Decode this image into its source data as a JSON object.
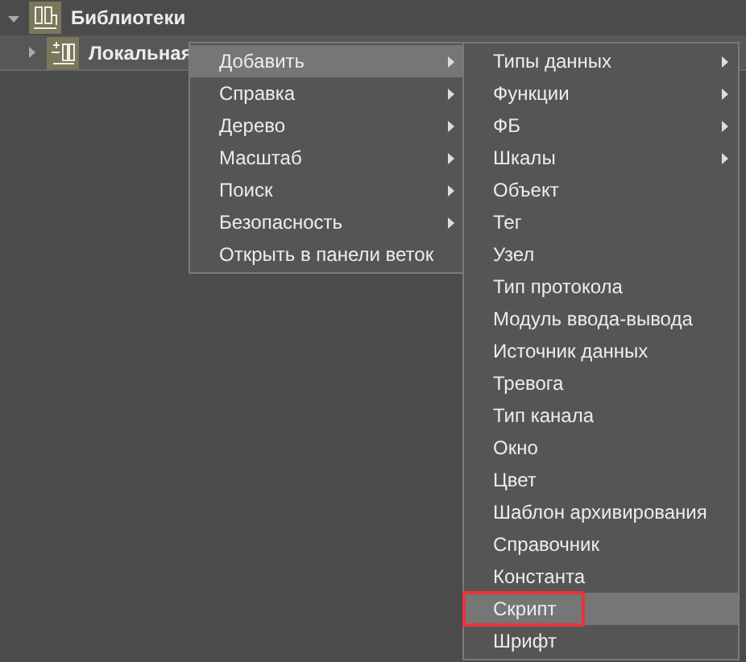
{
  "tree": [
    {
      "label": "Библиотеки",
      "expanded": true,
      "selected": false,
      "children": [
        {
          "label": "Локальная",
          "expanded": false,
          "selected": true
        }
      ]
    }
  ],
  "context_menu": {
    "items": [
      {
        "label": "Добавить",
        "submenu": true,
        "selected": true
      },
      {
        "label": "Справка",
        "submenu": true,
        "selected": false
      },
      {
        "label": "Дерево",
        "submenu": true,
        "selected": false
      },
      {
        "label": "Масштаб",
        "submenu": true,
        "selected": false
      },
      {
        "label": "Поиск",
        "submenu": true,
        "selected": false
      },
      {
        "label": "Безопасность",
        "submenu": true,
        "selected": false
      },
      {
        "label": "Открыть в панели веток",
        "submenu": false,
        "selected": false
      }
    ]
  },
  "add_submenu": {
    "items": [
      {
        "label": "Типы данных",
        "submenu": true,
        "selected": false,
        "highlighted": false
      },
      {
        "label": "Функции",
        "submenu": true,
        "selected": false,
        "highlighted": false
      },
      {
        "label": "ФБ",
        "submenu": true,
        "selected": false,
        "highlighted": false
      },
      {
        "label": "Шкалы",
        "submenu": true,
        "selected": false,
        "highlighted": false
      },
      {
        "label": "Объект",
        "submenu": false,
        "selected": false,
        "highlighted": false
      },
      {
        "label": "Тег",
        "submenu": false,
        "selected": false,
        "highlighted": false
      },
      {
        "label": "Узел",
        "submenu": false,
        "selected": false,
        "highlighted": false
      },
      {
        "label": "Тип протокола",
        "submenu": false,
        "selected": false,
        "highlighted": false
      },
      {
        "label": "Модуль ввода-вывода",
        "submenu": false,
        "selected": false,
        "highlighted": false
      },
      {
        "label": "Источник данных",
        "submenu": false,
        "selected": false,
        "highlighted": false
      },
      {
        "label": "Тревога",
        "submenu": false,
        "selected": false,
        "highlighted": false
      },
      {
        "label": "Тип канала",
        "submenu": false,
        "selected": false,
        "highlighted": false
      },
      {
        "label": "Окно",
        "submenu": false,
        "selected": false,
        "highlighted": false
      },
      {
        "label": "Цвет",
        "submenu": false,
        "selected": false,
        "highlighted": false
      },
      {
        "label": "Шаблон архивирования",
        "submenu": false,
        "selected": false,
        "highlighted": false
      },
      {
        "label": "Справочник",
        "submenu": false,
        "selected": false,
        "highlighted": false
      },
      {
        "label": "Константа",
        "submenu": false,
        "selected": false,
        "highlighted": false
      },
      {
        "label": "Скрипт",
        "submenu": false,
        "selected": true,
        "highlighted": true
      },
      {
        "label": "Шрифт",
        "submenu": false,
        "selected": false,
        "highlighted": false
      }
    ]
  }
}
